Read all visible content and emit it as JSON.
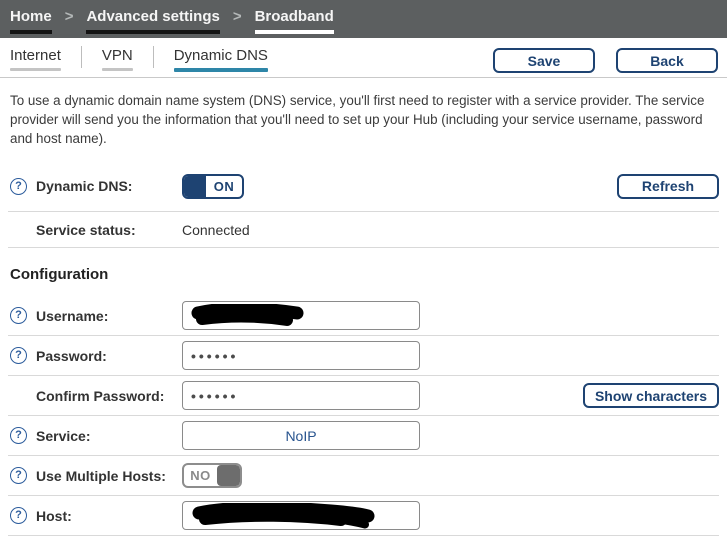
{
  "breadcrumb": {
    "separator": ">",
    "home": "Home",
    "advanced_settings": "Advanced settings",
    "broadband": "Broadband"
  },
  "tabs": {
    "internet": "Internet",
    "vpn": "VPN",
    "dynamic_dns": "Dynamic DNS"
  },
  "buttons": {
    "save": "Save",
    "back": "Back",
    "refresh": "Refresh",
    "show_characters": "Show characters"
  },
  "intro": "To use a dynamic domain name system (DNS) service, you'll first need to register with a service provider. The service provider will send you the information that you'll need to set up your Hub (including your service username, password and host name).",
  "section_heading": "Configuration",
  "help_icon_glyph": "?",
  "rows": {
    "dynamic_dns": {
      "label": "Dynamic DNS:",
      "toggle_value": "ON",
      "toggle_state": "on"
    },
    "service_status": {
      "label": "Service status:",
      "value": "Connected"
    },
    "username": {
      "label": "Username:",
      "redacted": true
    },
    "password": {
      "label": "Password:",
      "masked_value": "••••••"
    },
    "confirm_password": {
      "label": "Confirm Password:",
      "masked_value": "••••••"
    },
    "service": {
      "label": "Service:",
      "value": "NoIP"
    },
    "use_multiple_hosts": {
      "label": "Use Multiple Hosts:",
      "toggle_value": "NO",
      "toggle_state": "off"
    },
    "host": {
      "label": "Host:",
      "redacted": true
    }
  },
  "colors": {
    "navy": "#1e4372",
    "active_tab_accent": "#2e86a8",
    "breadcrumb_background": "#5c5f60",
    "divider": "#d9d9d9"
  }
}
